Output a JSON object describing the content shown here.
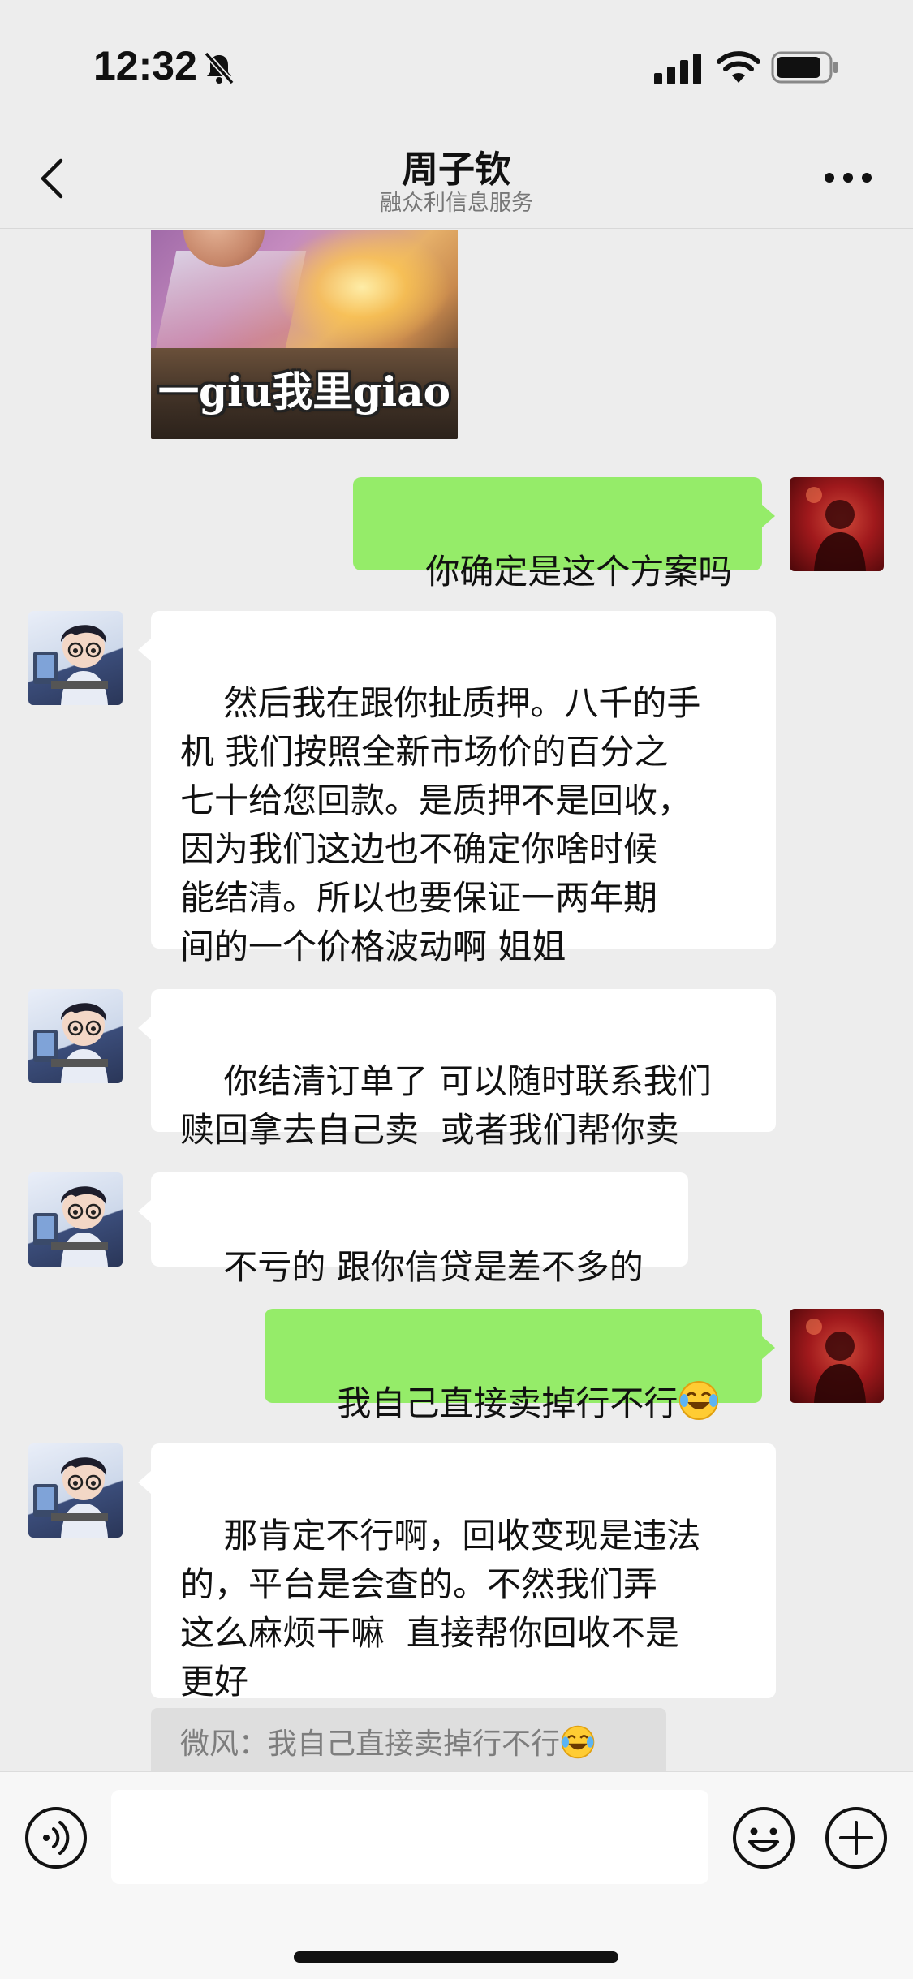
{
  "status_bar": {
    "time": "12:32"
  },
  "nav": {
    "title": "周子钦",
    "subtitle": "融众利信息服务"
  },
  "sticker": {
    "caption": "一giu我里giao"
  },
  "messages": [
    {
      "from": "me",
      "text": "你确定是这个方案吗"
    },
    {
      "from": "other",
      "text": "然后我在跟你扯质押。八千的手\n机 我们按照全新市场价的百分之\n七十给您回款。是质押不是回收，\n因为我们这边也不确定你啥时候\n能结清。所以也要保证一两年期\n间的一个价格波动啊 姐姐"
    },
    {
      "from": "other",
      "text": "你结清订单了 可以随时联系我们\n赎回拿去自己卖  或者我们帮你卖"
    },
    {
      "from": "other",
      "text": "不亏的 跟你信贷是差不多的"
    },
    {
      "from": "me",
      "text": "我自己直接卖掉行不行",
      "emoji": "laugh-cry-emoji"
    },
    {
      "from": "other",
      "text": "那肯定不行啊，回收变现是违法\n的，平台是会查的。不然我们弄\n这么麻烦干嘛  直接帮你回收不是\n更好"
    }
  ],
  "quote": {
    "text": "微风：我自己直接卖掉行不行",
    "emoji": "laugh-cry-emoji"
  },
  "input": {
    "placeholder": ""
  },
  "colors": {
    "background": "#ededed",
    "outgoing_bubble": "#95ec69",
    "incoming_bubble": "#ffffff"
  }
}
